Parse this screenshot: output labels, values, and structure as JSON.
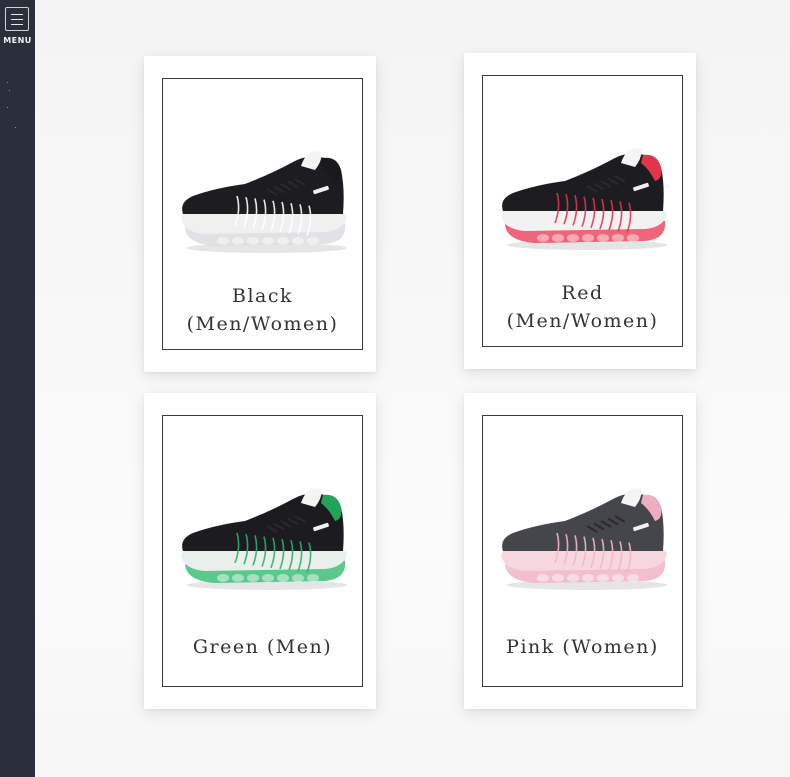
{
  "sidebar": {
    "menu_label": "MENU",
    "menu_icon": "hamburger-icon"
  },
  "products": [
    {
      "line1": "Black",
      "line2": "(Men/Women)",
      "upper": "#1d1d21",
      "accent": "#ffffff",
      "sole": "#f0f0f0",
      "airsole": "#dadde2",
      "collar": "#1a1a1e"
    },
    {
      "line1": "Red",
      "line2": "(Men/Women)",
      "upper": "#1d1d21",
      "accent": "#e3344e",
      "sole": "#f2f2f2",
      "airsole": "#ec4a63",
      "collar": "#e3344e"
    },
    {
      "line1": "Green  (Men)",
      "line2": "",
      "upper": "#1c1c20",
      "accent": "#2fae6a",
      "sole": "#e9efea",
      "airsole": "#3fbf78",
      "collar": "#22a35a"
    },
    {
      "line1": "Pink  (Women)",
      "line2": "",
      "upper": "#45464c",
      "accent": "#f2b7c9",
      "sole": "#f6d6df",
      "airsole": "#efb4c5",
      "collar": "#ecaec0"
    }
  ]
}
